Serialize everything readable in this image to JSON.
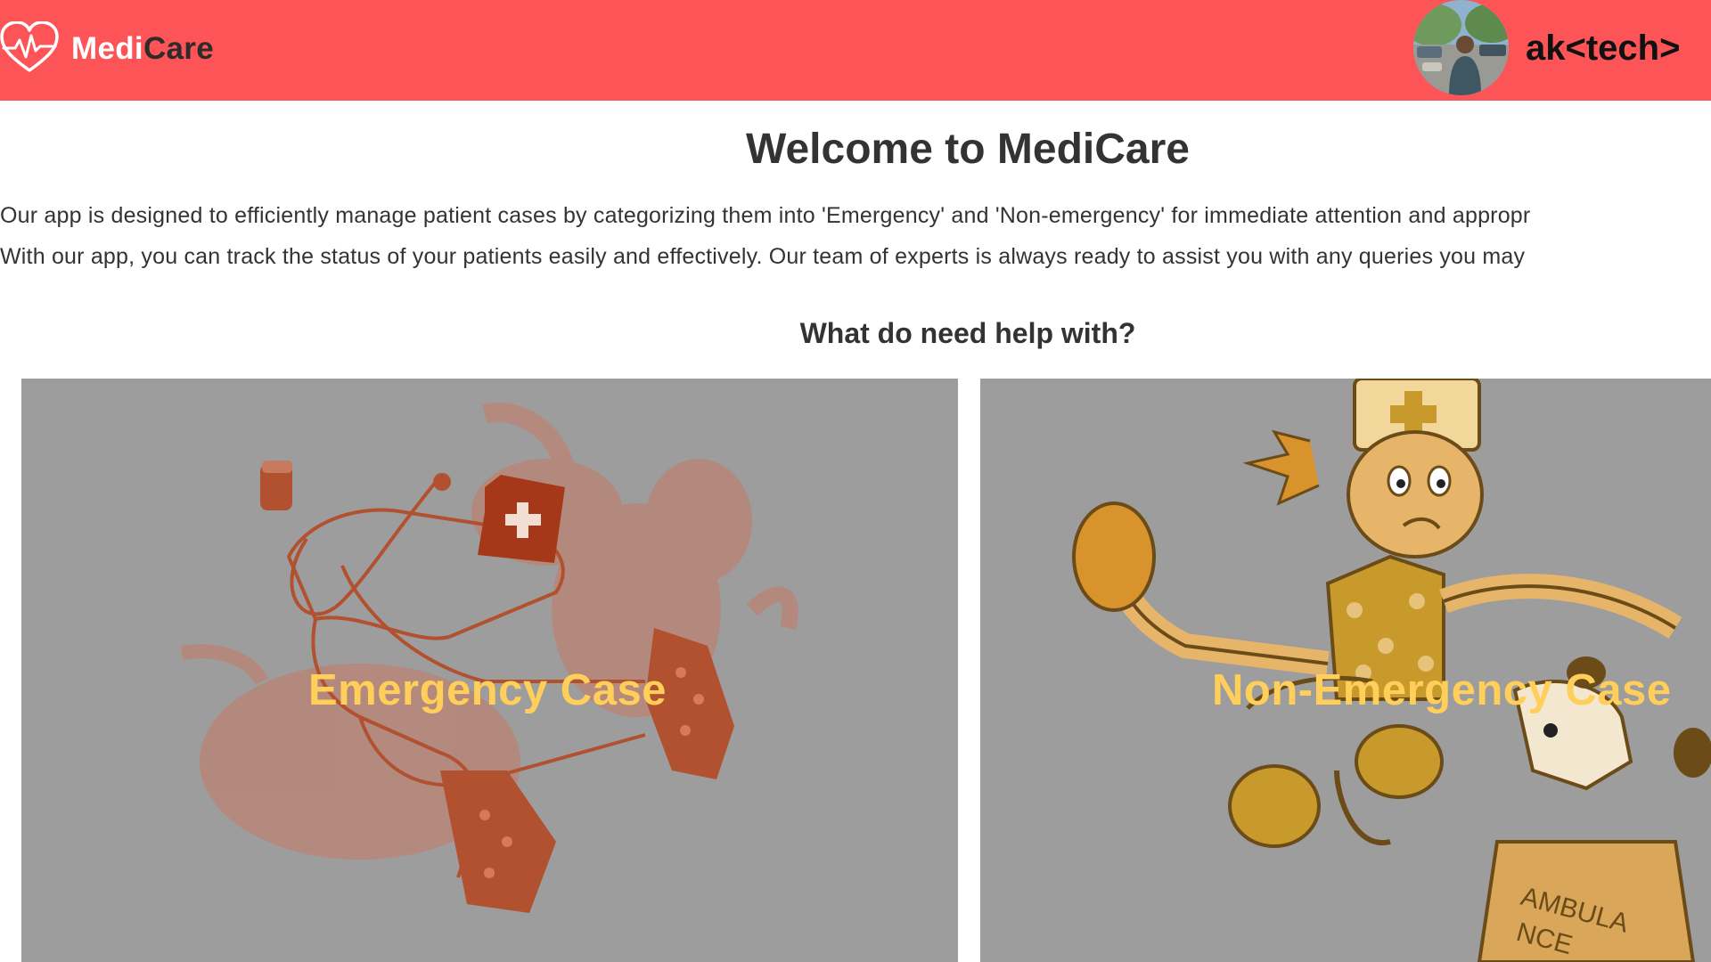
{
  "header": {
    "logo_medi": "Medi",
    "logo_care": "Care",
    "username": "ak<tech>"
  },
  "main": {
    "title": "Welcome to MediCare",
    "description_line1": "Our app is designed to efficiently manage patient cases by categorizing them into 'Emergency' and 'Non-emergency' for immediate attention and appropr",
    "description_line2": "With our app, you can track the status of your patients easily and effectively. Our team of experts is always ready to assist you with any queries you may",
    "help_question": "What do need help with?"
  },
  "cards": [
    {
      "label": "Emergency Case",
      "icon": "doctor-running-illustration"
    },
    {
      "label": "Non-Emergency Case",
      "icon": "cartoon-nurse-ambulance-illustration"
    }
  ],
  "colors": {
    "navbar": "#fc5457",
    "card_overlay": "#9d9d9d",
    "card_label": "#ffcf5a"
  }
}
